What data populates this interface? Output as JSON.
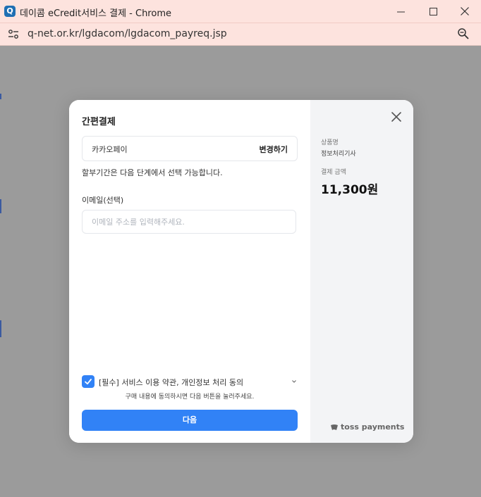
{
  "window": {
    "icon_letter": "Q",
    "title": "데이콤 eCredit서비스 결제 - Chrome",
    "url": "q-net.or.kr/lgdacom/lgdacom_payreq.jsp"
  },
  "modal": {
    "title": "간편결제",
    "payment_method": {
      "name": "카카오페이",
      "change_label": "변경하기"
    },
    "installment_note": "할부기간은 다음 단계에서 선택 가능합니다.",
    "email": {
      "label": "이메일(선택)",
      "value": "",
      "placeholder": "이메일 주소를 입력해주세요."
    },
    "agreement": {
      "checked": true,
      "label": "[필수] 서비스 이용 약관, 개인정보 처리 동의",
      "note": "구매 내용에 동의하시면 다음 버튼을 눌러주세요."
    },
    "next_label": "다음"
  },
  "summary": {
    "product_label": "상품명",
    "product_name": "정보처리기사",
    "amount_label": "결제 금액",
    "amount": "11,300원",
    "brand": "toss payments"
  },
  "colors": {
    "accent": "#3182f6",
    "titlebar": "#fde3de",
    "overlay": "#9b9b9b",
    "sidebar": "#f3f4f6"
  },
  "icons": [
    "site-info-icon",
    "minimize-icon",
    "maximize-icon",
    "close-window-icon",
    "zoom-icon",
    "close-icon",
    "check-icon",
    "chevron-down-icon",
    "toss-logo-icon"
  ]
}
